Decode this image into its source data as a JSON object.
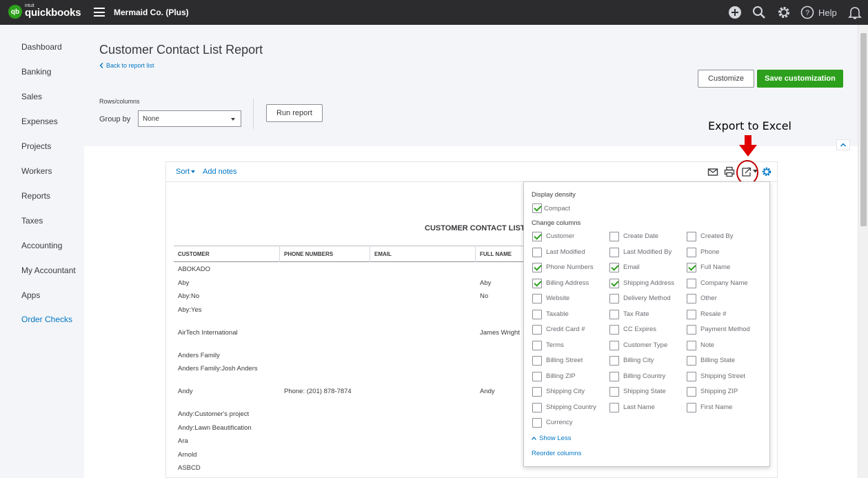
{
  "topbar": {
    "intuit": "intuit",
    "brand": "quickbooks",
    "logo_mark": "qb",
    "company": "Mermaid Co. (Plus)",
    "help": "Help"
  },
  "sidebar": {
    "items": [
      {
        "label": "Dashboard"
      },
      {
        "label": "Banking"
      },
      {
        "label": "Sales"
      },
      {
        "label": "Expenses"
      },
      {
        "label": "Projects"
      },
      {
        "label": "Workers"
      },
      {
        "label": "Reports"
      },
      {
        "label": "Taxes"
      },
      {
        "label": "Accounting"
      },
      {
        "label": "My Accountant"
      },
      {
        "label": "Apps"
      },
      {
        "label": "Order Checks"
      }
    ]
  },
  "header": {
    "title": "Customer Contact List Report",
    "back_link": "Back to report list",
    "customize": "Customize",
    "save_customization": "Save customization",
    "rows_columns": "Rows/columns",
    "group_by_label": "Group by",
    "group_by_value": "None",
    "run_report": "Run report"
  },
  "annotation": {
    "export_label": "Export to Excel"
  },
  "report": {
    "sort": "Sort",
    "add_notes": "Add notes",
    "title": "CUSTOMER CONTACT LIST",
    "columns": [
      "CUSTOMER",
      "PHONE NUMBERS",
      "EMAIL",
      "FULL NAME"
    ],
    "rows": [
      {
        "customer": "ABOKADO",
        "phone": "",
        "email": "",
        "full_name": ""
      },
      {
        "customer": "Aby",
        "phone": "",
        "email": "",
        "full_name": "Aby"
      },
      {
        "customer": "Aby:No",
        "phone": "",
        "email": "",
        "full_name": "No"
      },
      {
        "customer": "Aby:Yes",
        "phone": "",
        "email": "",
        "full_name": ""
      },
      {
        "customer": "AirTech International",
        "phone": "",
        "email": "",
        "full_name": "James Wright"
      },
      {
        "customer": "Anders Family",
        "phone": "",
        "email": "",
        "full_name": ""
      },
      {
        "customer": "Anders Family:Josh Anders",
        "phone": "",
        "email": "",
        "full_name": ""
      },
      {
        "customer": "Andy",
        "phone": "Phone: (201) 878-7874",
        "email": "",
        "full_name": "Andy"
      },
      {
        "customer": "Andy:Customer's project",
        "phone": "",
        "email": "",
        "full_name": ""
      },
      {
        "customer": "Andy:Lawn Beautification",
        "phone": "",
        "email": "",
        "full_name": ""
      },
      {
        "customer": "Ara",
        "phone": "",
        "email": "",
        "full_name": ""
      },
      {
        "customer": "Arnold",
        "phone": "",
        "email": "",
        "full_name": ""
      },
      {
        "customer": "ASBCD",
        "phone": "",
        "email": "",
        "full_name": ""
      }
    ]
  },
  "panel": {
    "display_density": "Display density",
    "compact": "Compact",
    "compact_checked": true,
    "change_columns": "Change columns",
    "columns": [
      {
        "label": "Customer",
        "checked": true
      },
      {
        "label": "Create Date",
        "checked": false
      },
      {
        "label": "Created By",
        "checked": false
      },
      {
        "label": "Last Modified",
        "checked": false
      },
      {
        "label": "Last Modified By",
        "checked": false
      },
      {
        "label": "Phone",
        "checked": false
      },
      {
        "label": "Phone Numbers",
        "checked": true
      },
      {
        "label": "Email",
        "checked": true
      },
      {
        "label": "Full Name",
        "checked": true
      },
      {
        "label": "Billing Address",
        "checked": true
      },
      {
        "label": "Shipping Address",
        "checked": true
      },
      {
        "label": "Company Name",
        "checked": false
      },
      {
        "label": "Website",
        "checked": false
      },
      {
        "label": "Delivery Method",
        "checked": false
      },
      {
        "label": "Other",
        "checked": false
      },
      {
        "label": "Taxable",
        "checked": false
      },
      {
        "label": "Tax Rate",
        "checked": false
      },
      {
        "label": "Resale #",
        "checked": false
      },
      {
        "label": "Credit Card #",
        "checked": false
      },
      {
        "label": "CC Expires",
        "checked": false
      },
      {
        "label": "Payment Method",
        "checked": false
      },
      {
        "label": "Terms",
        "checked": false
      },
      {
        "label": "Customer Type",
        "checked": false
      },
      {
        "label": "Note",
        "checked": false
      },
      {
        "label": "Billing Street",
        "checked": false
      },
      {
        "label": "Billing City",
        "checked": false
      },
      {
        "label": "Billing State",
        "checked": false
      },
      {
        "label": "Billing ZIP",
        "checked": false
      },
      {
        "label": "Billing Country",
        "checked": false
      },
      {
        "label": "Shipping Street",
        "checked": false
      },
      {
        "label": "Shipping City",
        "checked": false
      },
      {
        "label": "Shipping State",
        "checked": false
      },
      {
        "label": "Shipping ZIP",
        "checked": false
      },
      {
        "label": "Shipping Country",
        "checked": false
      },
      {
        "label": "Last Name",
        "checked": false
      },
      {
        "label": "First Name",
        "checked": false
      },
      {
        "label": "Currency",
        "checked": false
      }
    ],
    "show_less": "Show Less",
    "reorder_columns": "Reorder columns"
  },
  "colors": {
    "brand_green": "#2ca01c",
    "link_blue": "#0077c5",
    "topbar": "#2c2c2e",
    "annotation_red": "#c00000"
  }
}
